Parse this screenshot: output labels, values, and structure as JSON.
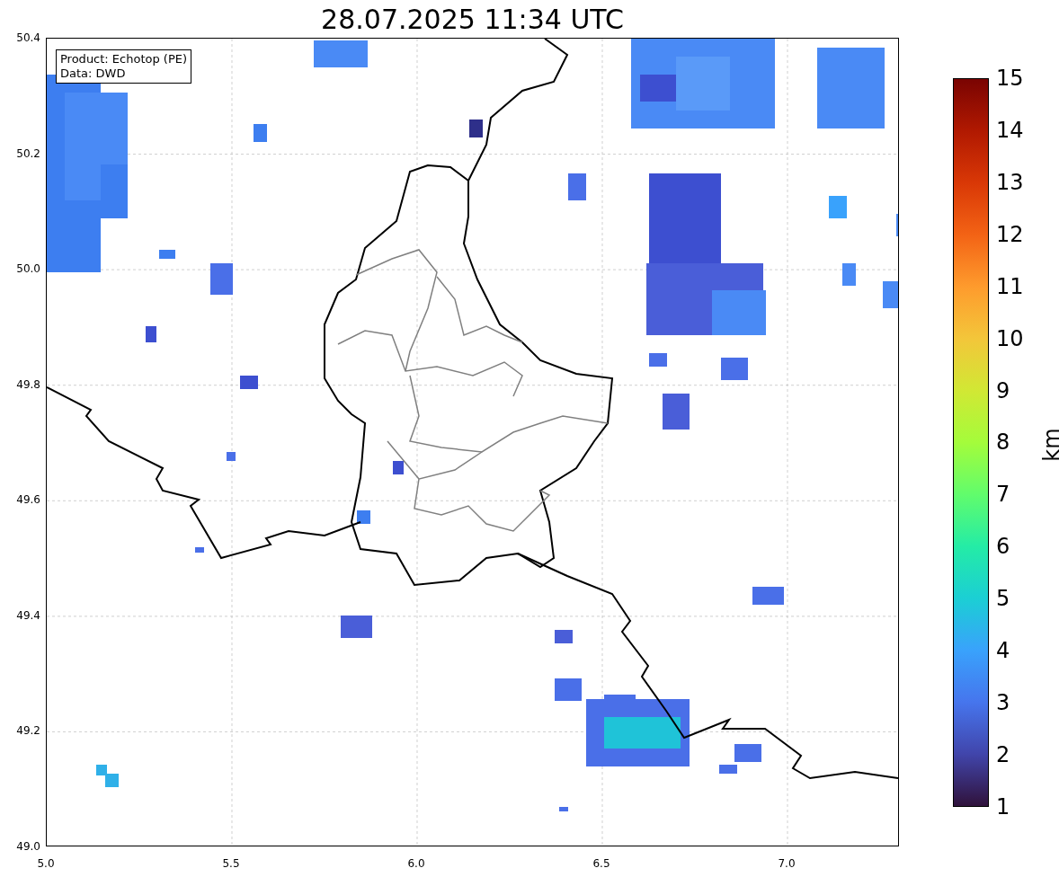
{
  "title": "28.07.2025 11:34 UTC",
  "info_box": [
    "Product: Echotop (PE)",
    "Data: DWD"
  ],
  "map": {
    "x_ticks": [
      "5.0",
      "5.5",
      "6.0",
      "6.5",
      "7.0"
    ],
    "y_ticks": [
      "50.4",
      "50.2",
      "50.0",
      "49.8",
      "49.6",
      "49.4",
      "49.2",
      "49.0"
    ]
  },
  "colorbar": {
    "label": "km",
    "ticks": [
      "15",
      "14",
      "13",
      "12",
      "11",
      "10",
      "9",
      "8",
      "7",
      "6",
      "5",
      "4",
      "3",
      "2",
      "1"
    ]
  }
}
